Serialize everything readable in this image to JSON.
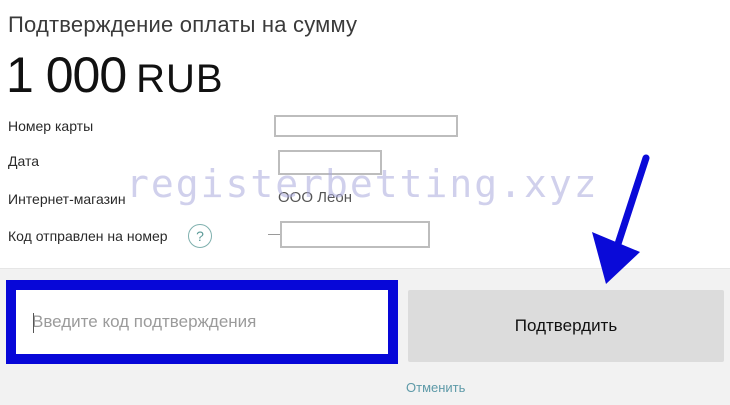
{
  "payment": {
    "title": "Подтверждение оплаты на сумму",
    "amount": "1 000",
    "currency": "RUB"
  },
  "fields": {
    "card_label": "Номер карты",
    "date_label": "Дата",
    "shop_label": "Интернет-магазин",
    "shop_value": "ООО Леон",
    "code_sent_label": "Код отправлен на номер",
    "help_glyph": "?"
  },
  "confirmation": {
    "code_placeholder": "Введите код подтверждения",
    "confirm_label": "Подтвердить",
    "cancel_label": "Отменить"
  },
  "overlay": {
    "watermark": "registerbetting.xyz",
    "highlight_color": "#0707d8",
    "arrow_color": "#0a0ad8",
    "arrow_icon": "arrow-down-icon"
  }
}
